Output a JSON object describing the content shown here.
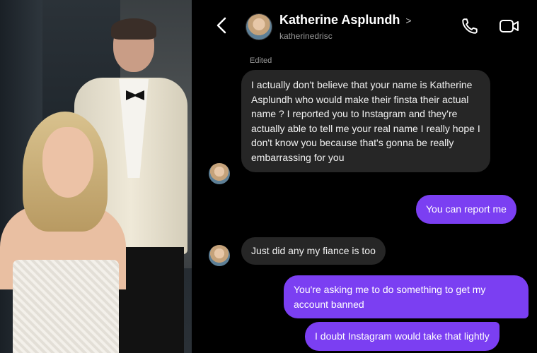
{
  "header": {
    "contact_name": "Katherine Asplundh",
    "name_chevron": ">",
    "username": "katherinedrisc",
    "back_icon": "chevron-left-icon",
    "call_icon": "phone-icon",
    "video_icon": "video-camera-icon"
  },
  "status": {
    "edited_label": "Edited"
  },
  "messages": [
    {
      "sender": "them",
      "text": "I actually don't believe that your name is Katherine Asplundh who would make their finsta their actual name ? I reported you to Instagram and they're actually able to tell me your real name I really hope I don't know you because that's gonna be really embarrassing for you"
    },
    {
      "sender": "me",
      "text": "You can report me"
    },
    {
      "sender": "them",
      "text": "Just did any my fiance is too"
    },
    {
      "sender": "me",
      "text": "You're asking me to do something to get my account banned"
    },
    {
      "sender": "me",
      "text": "I doubt Instagram would take that lightly"
    }
  ],
  "colors": {
    "outgoing_bubble": "#7b3ff2",
    "incoming_bubble": "#262626",
    "background": "#000000"
  }
}
